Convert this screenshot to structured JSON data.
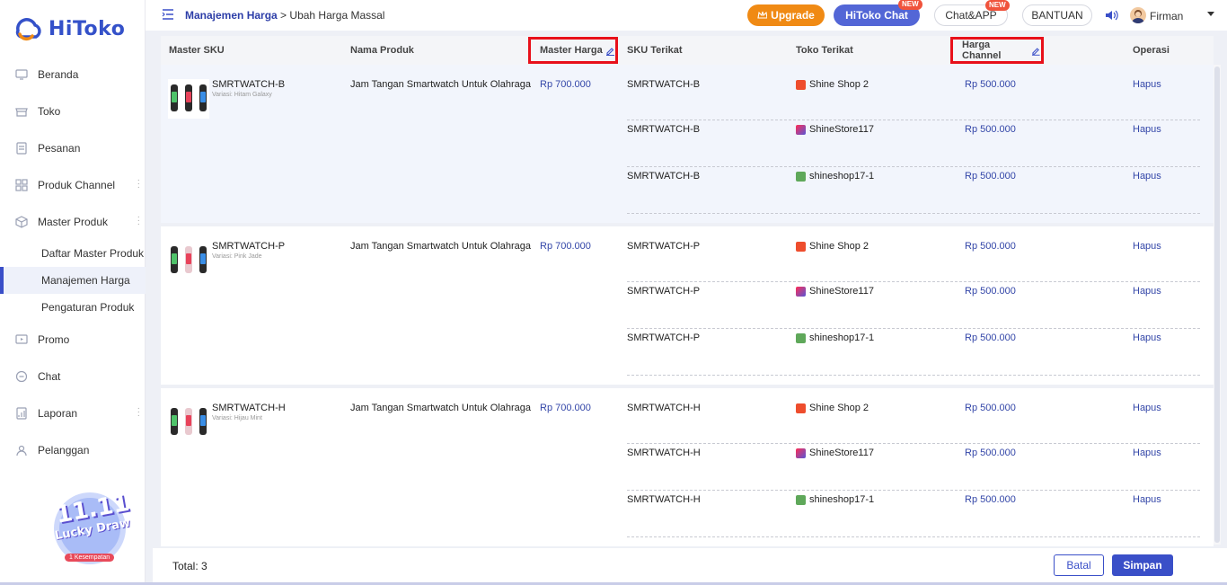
{
  "sidebar": {
    "logo_text": "HiToko",
    "items": [
      {
        "label": "Beranda",
        "icon": "monitor-icon"
      },
      {
        "label": "Toko",
        "icon": "store-icon"
      },
      {
        "label": "Pesanan",
        "icon": "order-icon"
      },
      {
        "label": "Produk Channel",
        "icon": "grid-icon"
      },
      {
        "label": "Master Produk",
        "icon": "cube-icon"
      }
    ],
    "sub_items": [
      {
        "label": "Daftar Master Produk"
      },
      {
        "label": "Manajemen Harga"
      },
      {
        "label": "Pengaturan Produk"
      }
    ],
    "items_after": [
      {
        "label": "Promo",
        "icon": "promo-icon"
      },
      {
        "label": "Chat",
        "icon": "chat-icon"
      },
      {
        "label": "Laporan",
        "icon": "report-icon"
      },
      {
        "label": "Pelanggan",
        "icon": "customer-icon"
      }
    ],
    "promo": {
      "line1": "11.11",
      "line2": "Lucky Draw",
      "badge": "1 Kesempatan"
    }
  },
  "header": {
    "breadcrumb_main": "Manajemen Harga",
    "breadcrumb_sep": ">",
    "breadcrumb_current": "Ubah Harga Massal",
    "upgrade_label": "Upgrade",
    "chat_label": "HiToko Chat",
    "app_label": "Chat&APP",
    "help_label": "BANTUAN",
    "new_badge": "NEW",
    "user_name": "Firman"
  },
  "table": {
    "columns": {
      "master_sku": "Master SKU",
      "product_name": "Nama Produk",
      "master_price": "Master Harga",
      "linked_sku": "SKU Terikat",
      "linked_store": "Toko Terikat",
      "channel_price": "Harga Channel",
      "operation": "Operasi"
    },
    "groups": [
      {
        "sku": "SMRTWATCH-B",
        "variant": "Variasi: Hitam Galaxy",
        "product_name": "Jam Tangan Smartwatch Untuk Olahraga",
        "master_price": "Rp 700.000",
        "rows": [
          {
            "sku": "SMRTWATCH-B",
            "store": "Shine Shop 2",
            "price": "Rp 500.000",
            "op": "Hapus"
          },
          {
            "sku": "SMRTWATCH-B",
            "store": "ShineStore117",
            "price": "Rp 500.000",
            "op": "Hapus"
          },
          {
            "sku": "SMRTWATCH-B",
            "store": "shineshop17-1",
            "price": "Rp 500.000",
            "op": "Hapus"
          }
        ]
      },
      {
        "sku": "SMRTWATCH-P",
        "variant": "Variasi: Pink Jade",
        "product_name": "Jam Tangan Smartwatch Untuk Olahraga",
        "master_price": "Rp 700.000",
        "rows": [
          {
            "sku": "SMRTWATCH-P",
            "store": "Shine Shop 2",
            "price": "Rp 500.000",
            "op": "Hapus"
          },
          {
            "sku": "SMRTWATCH-P",
            "store": "ShineStore117",
            "price": "Rp 500.000",
            "op": "Hapus"
          },
          {
            "sku": "SMRTWATCH-P",
            "store": "shineshop17-1",
            "price": "Rp 500.000",
            "op": "Hapus"
          }
        ]
      },
      {
        "sku": "SMRTWATCH-H",
        "variant": "Variasi: Hijau Mint",
        "product_name": "Jam Tangan Smartwatch Untuk Olahraga",
        "master_price": "Rp 700.000",
        "rows": [
          {
            "sku": "SMRTWATCH-H",
            "store": "Shine Shop 2",
            "price": "Rp 500.000",
            "op": "Hapus"
          },
          {
            "sku": "SMRTWATCH-H",
            "store": "ShineStore117",
            "price": "Rp 500.000",
            "op": "Hapus"
          },
          {
            "sku": "SMRTWATCH-H",
            "store": "shineshop17-1",
            "price": "Rp 500.000",
            "op": "Hapus"
          }
        ]
      }
    ]
  },
  "footer": {
    "total_label": "Total: 3",
    "cancel_label": "Batal",
    "save_label": "Simpan"
  },
  "colors": {
    "accent": "#3a4fc8",
    "upgrade": "#f08a14",
    "highlight_box": "#e8101a"
  }
}
